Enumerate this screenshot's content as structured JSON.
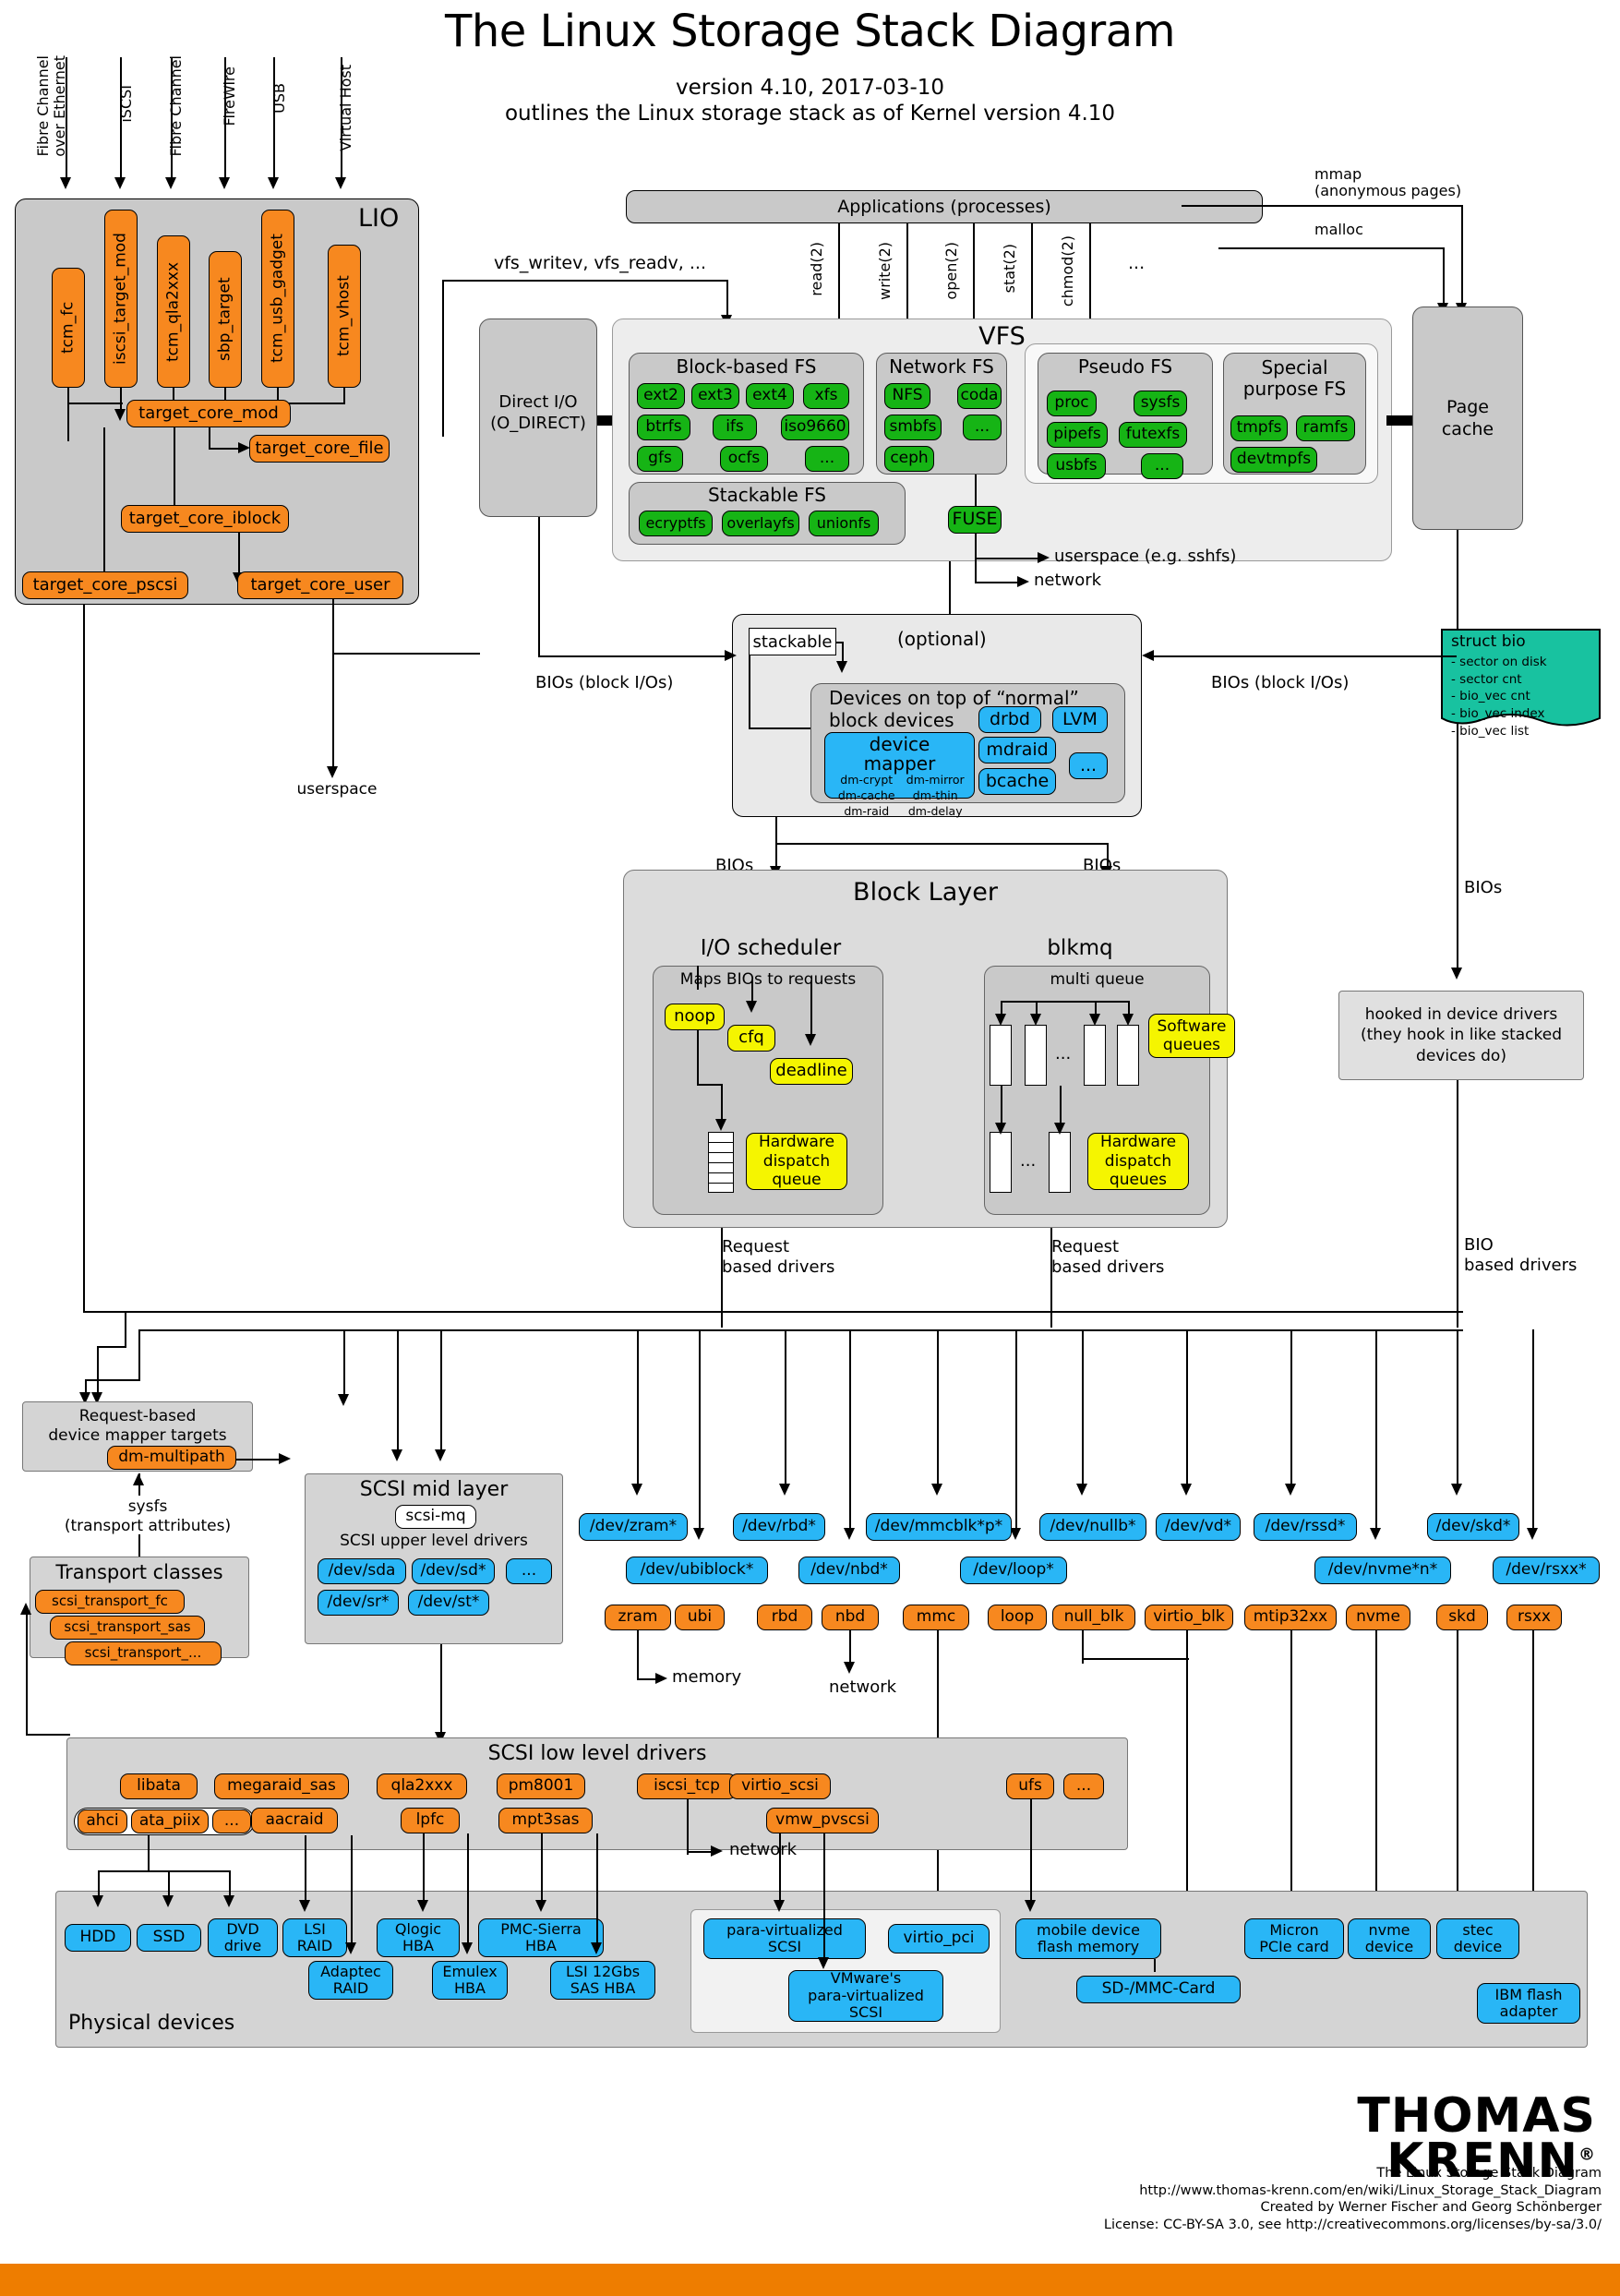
{
  "header": {
    "title": "The Linux Storage Stack Diagram",
    "subtitle1": "version 4.10, 2017-03-10",
    "subtitle2": "outlines the Linux storage stack as of Kernel version 4.10"
  },
  "transport_arrows": [
    {
      "label": "Fibre Channel\nover Ethernet"
    },
    {
      "label": "iSCSI"
    },
    {
      "label": "Fibre Channel"
    },
    {
      "label": "FireWire"
    },
    {
      "label": "USB"
    },
    {
      "label": "Virtual Host"
    }
  ],
  "lio": {
    "title": "LIO",
    "fabric_modules": [
      "tcm_fc",
      "iscsi_target_mod",
      "tcm_qla2xxx",
      "sbp_target",
      "tcm_usb_gadget",
      "tcm_vhost"
    ],
    "core": "target_core_mod",
    "backstores": [
      "target_core_file",
      "target_core_iblock",
      "target_core_pscsi",
      "target_core_user"
    ],
    "userspace_label": "userspace"
  },
  "applications": {
    "label": "Applications (processes)",
    "syscalls": [
      "read(2)",
      "write(2)",
      "open(2)",
      "stat(2)",
      "chmod(2)",
      "..."
    ],
    "mmap_label": "mmap\n(anonymous pages)",
    "malloc_label": "malloc",
    "vfs_helpers": "vfs_writev, vfs_readv, ..."
  },
  "direct_io": {
    "label": "Direct I/O\n(O_DIRECT)"
  },
  "vfs": {
    "title": "VFS",
    "groups": [
      {
        "title": "Block-based FS",
        "items": [
          "ext2",
          "ext3",
          "ext4",
          "xfs",
          "btrfs",
          "ifs",
          "iso9660",
          "gfs",
          "ocfs",
          "..."
        ]
      },
      {
        "title": "Network FS",
        "items": [
          "NFS",
          "coda",
          "smbfs",
          "...",
          "ceph"
        ]
      },
      {
        "title": "Pseudo FS",
        "items": [
          "proc",
          "sysfs",
          "pipefs",
          "futexfs",
          "usbfs",
          "..."
        ]
      },
      {
        "title": "Special\npurpose FS",
        "items": [
          "tmpfs",
          "ramfs",
          "devtmpfs"
        ]
      },
      {
        "title": "Stackable FS",
        "items": [
          "ecryptfs",
          "overlayfs",
          "unionfs"
        ]
      }
    ],
    "fuse": "FUSE",
    "fuse_targets": [
      "userspace (e.g. sshfs)",
      "network"
    ]
  },
  "page_cache": {
    "label": "Page\ncache"
  },
  "struct_bio": {
    "title": "struct bio",
    "fields": [
      "- sector on disk",
      "- sector cnt",
      "- bio_vec cnt",
      "- bio_vec index",
      "- bio_vec list"
    ]
  },
  "stackable_devices": {
    "stackable_tag": "stackable",
    "optional_tag": "(optional)",
    "title": "Devices on top of “normal”\nblock devices",
    "device_mapper": {
      "title": "device mapper",
      "targets": [
        "dm-crypt",
        "dm-mirror",
        "dm-cache",
        "dm-thin",
        "dm-raid",
        "dm-delay"
      ]
    },
    "others": [
      "drbd",
      "LVM",
      "mdraid",
      "bcache",
      "..."
    ],
    "bio_label_left": "BIOs (block I/Os)",
    "bio_label_right": "BIOs (block I/Os)"
  },
  "block_layer": {
    "title": "Block Layer",
    "bio_labels": [
      "BIOs",
      "BIOs",
      "BIOs"
    ],
    "io_scheduler": {
      "title": "I/O scheduler",
      "subtitle": "Maps BIOs to requests",
      "schedulers": [
        "noop",
        "cfq",
        "deadline"
      ],
      "dispatch": "Hardware\ndispatch\nqueue"
    },
    "blkmq": {
      "title": "blkmq",
      "subtitle": "multi queue",
      "software_queues": "Software\nqueues",
      "dispatch": "Hardware\ndispatch\nqueues"
    },
    "driver_labels": [
      "Request\nbased drivers",
      "Request\nbased drivers",
      "BIO\nbased drivers"
    ],
    "hooked_note": "hooked in device drivers\n(they hook in like stacked\ndevices do)"
  },
  "dm_targets": {
    "title": "Request-based\ndevice mapper targets",
    "item": "dm-multipath"
  },
  "transport_classes": {
    "title": "Transport classes",
    "items": [
      "scsi_transport_fc",
      "scsi_transport_sas",
      "scsi_transport_..."
    ],
    "sysfs_label": "sysfs\n(transport attributes)"
  },
  "scsi_mid": {
    "title": "SCSI mid layer",
    "mq": "scsi-mq",
    "upper_title": "SCSI upper level drivers",
    "devices": [
      "/dev/sda",
      "/dev/sd*",
      "...",
      "/dev/sr*",
      "/dev/st*"
    ]
  },
  "scsi_low": {
    "title": "SCSI low level drivers",
    "row1": [
      "libata",
      "megaraid_sas",
      "qla2xxx",
      "pm8001",
      "iscsi_tcp",
      "virtio_scsi",
      "ufs",
      "..."
    ],
    "row2": [
      "ahci",
      "ata_piix",
      "...",
      "aacraid",
      "lpfc",
      "mpt3sas",
      "vmw_pvscsi"
    ],
    "network_label": "network"
  },
  "block_devices": {
    "row1": [
      "/dev/zram*",
      "/dev/rbd*",
      "/dev/mmcblk*p*",
      "/dev/nullb*",
      "/dev/vd*",
      "/dev/rssd*",
      "/dev/skd*"
    ],
    "row2": [
      "/dev/ubiblock*",
      "/dev/nbd*",
      "/dev/loop*",
      "/dev/nvme*n*",
      "/dev/rsxx*"
    ],
    "drivers": [
      "zram",
      "ubi",
      "rbd",
      "nbd",
      "mmc",
      "loop",
      "null_blk",
      "virtio_blk",
      "mtip32xx",
      "nvme",
      "skd",
      "rsxx"
    ],
    "memory_label": "memory",
    "network_label": "network"
  },
  "physical": {
    "title": "Physical devices",
    "items": [
      "HDD",
      "SSD",
      "DVD\ndrive",
      "LSI\nRAID",
      "Qlogic\nHBA",
      "PMC-Sierra\nHBA",
      "para-virtualized\nSCSI",
      "virtio_pci",
      "mobile device\nflash memory",
      "Micron\nPCIe card",
      "nvme\ndevice",
      "stec\ndevice"
    ],
    "items2": [
      "Adaptec\nRAID",
      "Emulex\nHBA",
      "LSI 12Gbs\nSAS HBA",
      "VMware's\npara-virtualized\nSCSI",
      "SD-/MMC-Card",
      "IBM flash\nadapter"
    ]
  },
  "footer": {
    "lines": [
      "The Linux Storage Stack Diagram",
      "http://www.thomas-krenn.com/en/wiki/Linux_Storage_Stack_Diagram",
      "Created by Werner Fischer and Georg Schönberger",
      "License: CC-BY-SA 3.0, see http://creativecommons.org/licenses/by-sa/3.0/"
    ],
    "brand_line1": "THOMAS",
    "brand_line2": "KRENN",
    "brand_reg": "®"
  }
}
